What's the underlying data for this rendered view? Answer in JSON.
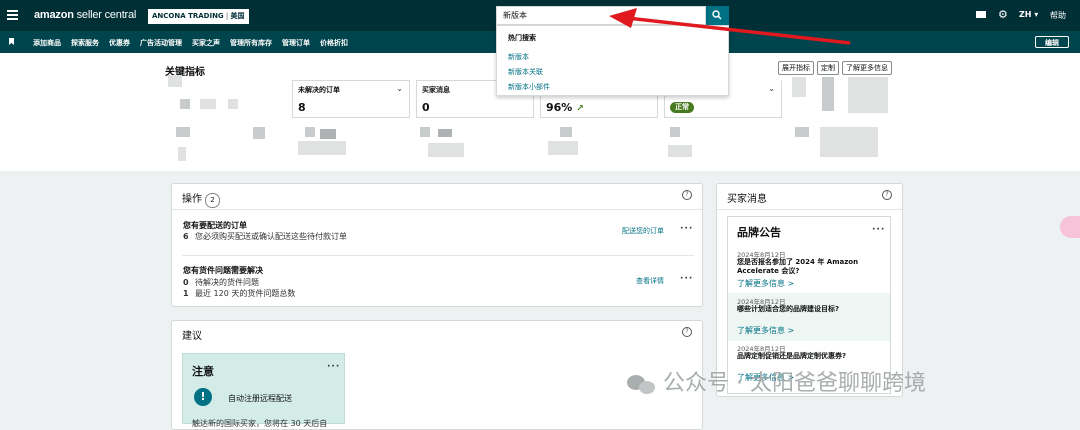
{
  "topbar": {
    "brand": "amazon",
    "brand_sub": " seller central",
    "account": "ANCONA TRADING",
    "account_sep": " | ",
    "marketplace": "美国",
    "search_value": "新版本",
    "lang": "ZH ▾",
    "help": "帮助",
    "colors": {
      "bar": "#002f36",
      "nav": "#00444d",
      "accent": "#007185"
    }
  },
  "nav": {
    "items": [
      "添加商品",
      "探索服务",
      "优惠券",
      "广告活动管理",
      "买家之声",
      "管理所有库存",
      "管理订单",
      "价格折扣"
    ],
    "edit": "编辑"
  },
  "search_dropdown": {
    "heading": "热门搜索",
    "items": [
      "新版本",
      "新版本关联",
      "新版本小部件"
    ]
  },
  "kpi": {
    "title": "关键指标",
    "buttons": [
      "展开指标",
      "定制",
      "了解更多信息"
    ],
    "cards": [
      {
        "label": "未解决的订单",
        "value": "8"
      },
      {
        "label": "买家消息",
        "value": "0"
      },
      {
        "label": "",
        "value": "96%"
      },
      {
        "label": "",
        "value": "正常"
      }
    ]
  },
  "actions": {
    "title": "操作",
    "count": "2",
    "task1": {
      "title": "您有要配送的订单",
      "num": "6",
      "text": "您必须购买配送或确认配送这些待付款订单",
      "link": "配送您的订单"
    },
    "task2": {
      "title": "您有货件问题需要解决",
      "num1": "0",
      "text1": "待解决的货件问题",
      "num2": "1",
      "text2": "最近 120 天的货件问题总数",
      "link": "查看详情"
    }
  },
  "suggest": {
    "title": "建议",
    "card_title": "注意",
    "card_text": "自动注册远程配送",
    "card_cut": "触达新的国际买家，您将在 30 天后自"
  },
  "buyer_msg": {
    "title": "买家消息",
    "card_title": "品牌公告",
    "items": [
      {
        "date": "2024年8月12日",
        "title": "您是否报名参加了 2024 年 Amazon Accelerate 会议?",
        "link": "了解更多信息 >"
      },
      {
        "date": "2024年8月12日",
        "title": "哪些计划适合您的品牌建设目标?",
        "link": "了解更多信息 >"
      },
      {
        "date": "2024年8月12日",
        "title": "品牌定制促销还是品牌定制优惠券?",
        "link": "了解更多信息 >"
      }
    ]
  },
  "watermark": "公众号 · 太阳爸爸聊聊跨境"
}
